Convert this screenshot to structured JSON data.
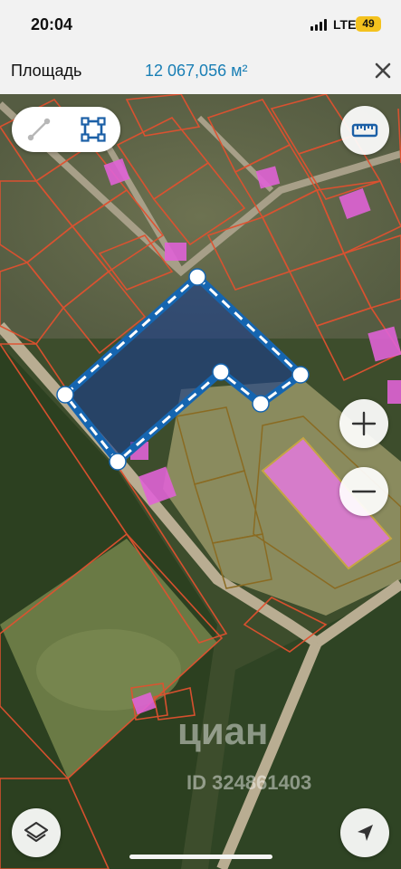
{
  "status_bar": {
    "time": "20:04",
    "network": "LTE",
    "battery": "49",
    "battery_color": "#f4c21e"
  },
  "header": {
    "area_label": "Площадь",
    "area_value": "12 067,056 м²",
    "accent_color": "#1a7fb5",
    "close_icon": "close-icon"
  },
  "map": {
    "polygon_color": "#1565b0",
    "polygon_vertex_count": 7,
    "cadastral_line_color": "#e0512f",
    "highlight_color": "#e062d6"
  },
  "toolbar": {
    "tools": [
      {
        "name": "line-tool",
        "icon": "line-measure-icon",
        "active": false
      },
      {
        "name": "area-tool",
        "icon": "polygon-area-icon",
        "active": true
      }
    ]
  },
  "controls": {
    "ruler_icon": "ruler-icon",
    "zoom_in_icon": "plus-icon",
    "zoom_out_icon": "minus-icon",
    "layers_icon": "layers-icon",
    "location_icon": "location-arrow-icon"
  },
  "watermark": {
    "brand": "циан",
    "id_text": "ID 324861403"
  }
}
